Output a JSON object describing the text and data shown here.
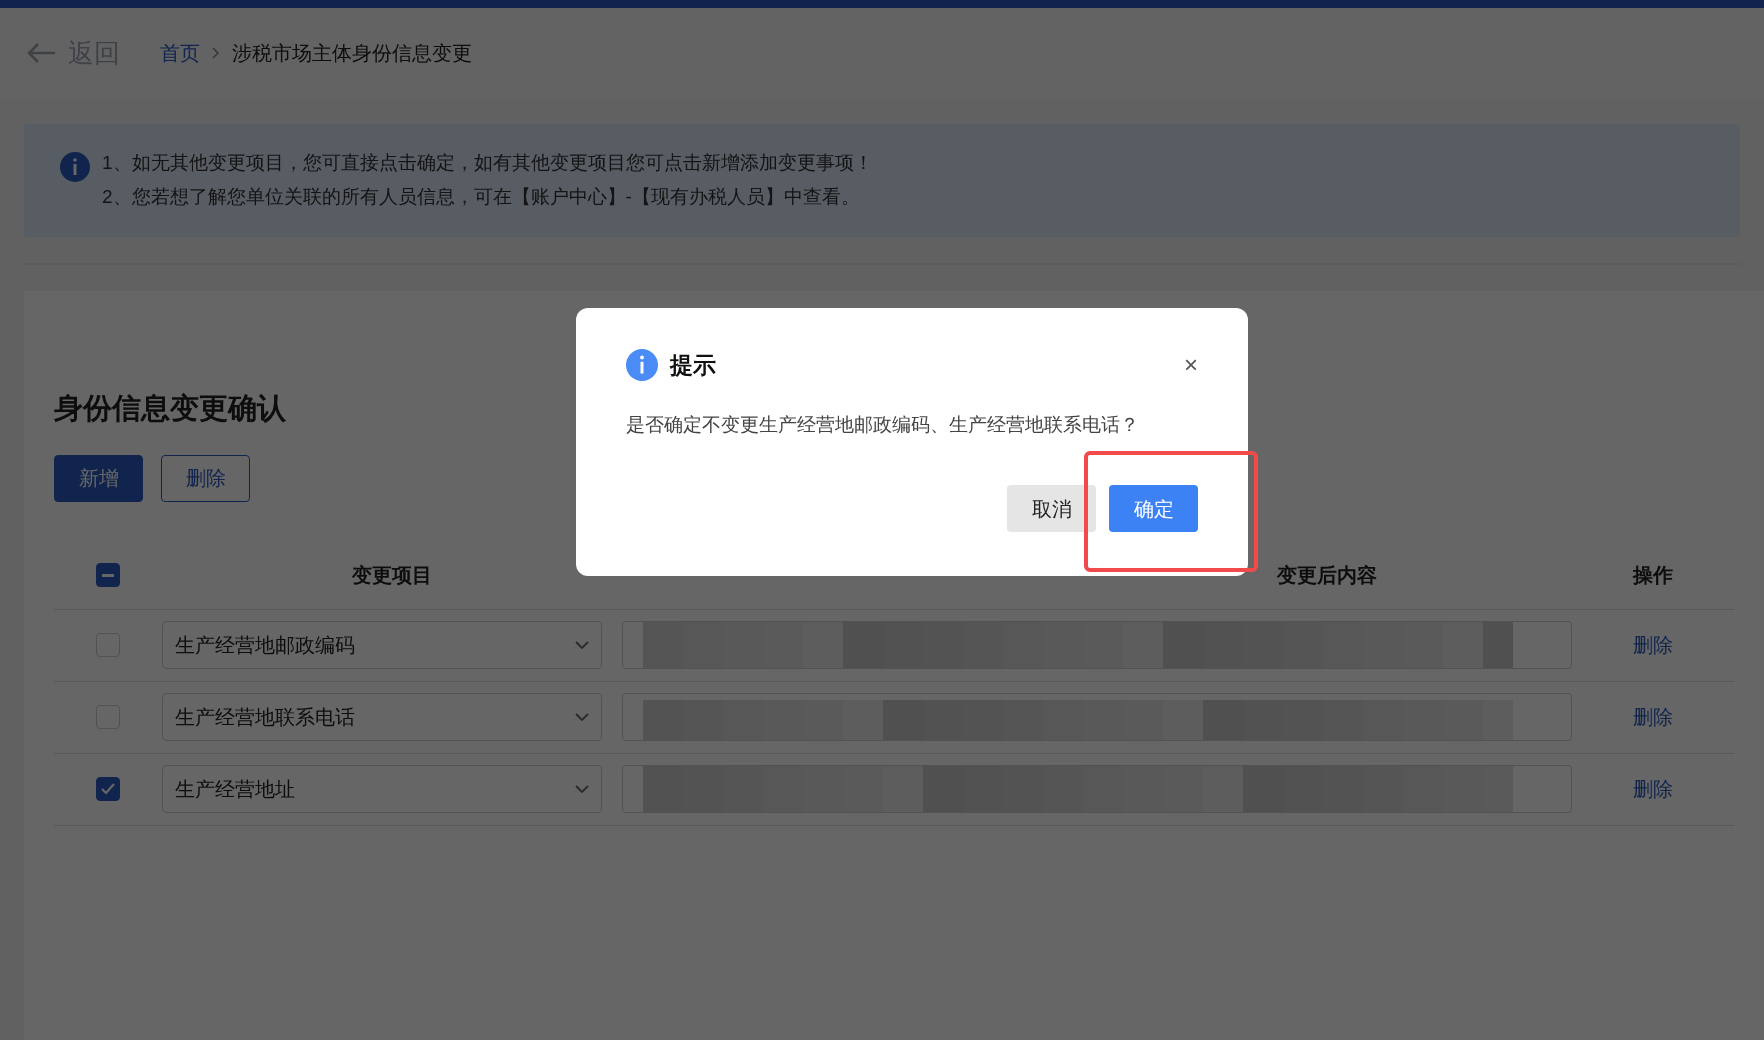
{
  "header": {
    "back_label": "返回",
    "breadcrumb": [
      "首页",
      "涉税市场主体身份信息变更"
    ]
  },
  "notice": {
    "lines": [
      "1、如无其他变更项目，您可直接点击确定，如有其他变更项目您可点击新增添加变更事项！",
      "2、您若想了解您单位关联的所有人员信息，可在【账户中心】-【现有办税人员】中查看。"
    ]
  },
  "section": {
    "title": "身份信息变更确认",
    "buttons": [
      {
        "label": "新增",
        "kind": "primary"
      },
      {
        "label": "删除",
        "kind": "outline"
      }
    ]
  },
  "table": {
    "select_all": {
      "indeterminate": true
    },
    "column_headers": {
      "item": "变更项目",
      "after": "变更后内容",
      "action": "操作"
    },
    "rows": [
      {
        "checked": false,
        "item": "生产经营地邮政编码",
        "action": "删除"
      },
      {
        "checked": false,
        "item": "生产经营地联系电话",
        "action": "删除"
      },
      {
        "checked": true,
        "item": "生产经营地址",
        "action": "删除"
      }
    ]
  },
  "dialog": {
    "title": "提示",
    "message": "是否确定不变更生产经营地邮政编码、生产经营地联系电话？",
    "close": "×",
    "buttons": [
      {
        "label": "取消",
        "kind": "secondary"
      },
      {
        "label": "确定",
        "kind": "primary",
        "highlighted": true
      }
    ]
  }
}
